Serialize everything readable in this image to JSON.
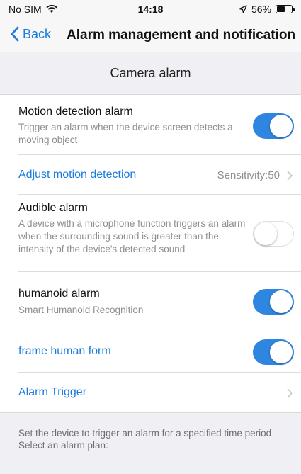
{
  "status_bar": {
    "carrier": "No SIM",
    "time": "14:18",
    "battery_percent": "56%",
    "battery_level": 0.56
  },
  "nav": {
    "back_label": "Back",
    "title": "Alarm management and notification"
  },
  "section_header": "Camera alarm",
  "rows": {
    "motion": {
      "title": "Motion detection alarm",
      "desc": "Trigger an alarm when the device screen detects a moving object",
      "enabled": true
    },
    "adjust": {
      "title": "Adjust motion detection",
      "value": "Sensitivity:50"
    },
    "audible": {
      "title": "Audible alarm",
      "desc": "A device with a microphone function triggers an alarm when the surrounding sound is greater than the intensity of the device's detected sound",
      "enabled": false
    },
    "humanoid": {
      "title": "humanoid alarm",
      "desc": "Smart Humanoid Recognition",
      "enabled": true
    },
    "frame": {
      "title": "frame human form",
      "enabled": true
    },
    "trigger": {
      "title": "Alarm Trigger"
    }
  },
  "footer": {
    "line1": "Set the device to trigger an alarm for a specified time period",
    "line2": "Select an alarm plan:"
  },
  "colors": {
    "accent": "#2f86e0",
    "link": "#1a7ce0",
    "group_bg": "#efeff4"
  }
}
